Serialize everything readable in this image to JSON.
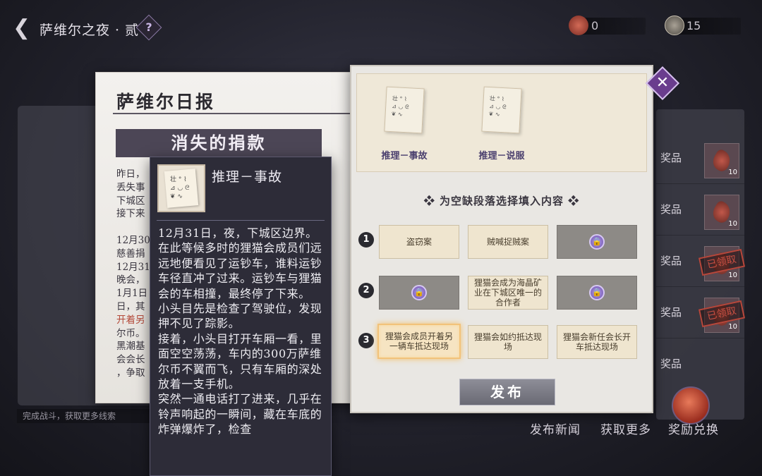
{
  "header": {
    "title": "萨维尔之夜 · 贰",
    "help_label": "?",
    "back_icon": "chevron-left-icon",
    "resources": [
      {
        "icon": "maple-leaf-icon",
        "value": "0",
        "color": "#c2584a"
      },
      {
        "icon": "coin-icon",
        "value": "15",
        "color": "#b8b0a0"
      }
    ]
  },
  "background": {
    "left_footer": "完成战斗，获取更多线索",
    "rewards": [
      {
        "label": "奖品",
        "count": "10",
        "claimed": false
      },
      {
        "label": "奖品",
        "count": "10",
        "claimed": false
      },
      {
        "label": "奖品",
        "count": "10",
        "claimed": true
      },
      {
        "label": "奖品",
        "count": "10",
        "claimed": true
      },
      {
        "label": "奖品",
        "count": "",
        "claimed": false
      }
    ],
    "claimed_text": "已领取",
    "bottom_buttons": [
      "发布新闻",
      "获取更多",
      "奖励兑换"
    ]
  },
  "newspaper": {
    "masthead": "萨维尔日报",
    "headline": "消失的捐款",
    "column_lines": [
      {
        "text": "昨日，",
        "red": false
      },
      {
        "text": "丢失事",
        "red": false
      },
      {
        "text": "下城区",
        "red": false
      },
      {
        "text": "接下来",
        "red": false
      },
      {
        "text": "",
        "red": false
      },
      {
        "text": "12月30",
        "red": false
      },
      {
        "text": "慈善捐",
        "red": false
      },
      {
        "text": "12月31",
        "red": false
      },
      {
        "text": "晚会，",
        "red": false
      },
      {
        "text": "1月1日",
        "red": false
      },
      {
        "text": "日，其",
        "red": false
      },
      {
        "text": "开着另",
        "red": true
      },
      {
        "text": "尔币。",
        "red": false
      },
      {
        "text": "黑潮基",
        "red": false
      },
      {
        "text": "会会长",
        "red": false
      },
      {
        "text": "，争取",
        "red": false
      }
    ]
  },
  "tooltip": {
    "title": "推理－事故",
    "body": "12月31日，夜，下城区边界。\n在此等候多时的狸猫会成员们远远地便看见了运钞车，谁料运钞车径直冲了过来。运钞车与狸猫会的车相撞，最终停了下来。\n小头目先是检查了驾驶位，发现押不见了踪影。\n接着，小头目打开车厢一看，里面空空荡荡，车内的300万萨维尔币不翼而飞，只有车厢的深处放着一支手机。\n突然一通电话打了进来，几乎在铃声响起的一瞬间，藏在车底的炸弹爆炸了，检查"
  },
  "quiz": {
    "clues": [
      {
        "label": "推理－事故"
      },
      {
        "label": "推理－说服"
      }
    ],
    "instruction": "为空缺段落选择填入内容",
    "rows": [
      {
        "num": "1",
        "options": [
          {
            "text": "盗窃案",
            "state": "normal"
          },
          {
            "text": "贼喊捉贼案",
            "state": "normal"
          },
          {
            "text": "",
            "state": "locked"
          }
        ]
      },
      {
        "num": "2",
        "options": [
          {
            "text": "",
            "state": "locked"
          },
          {
            "text": "狸猫会成为海晶矿业在下城区唯一的合作者",
            "state": "normal"
          },
          {
            "text": "",
            "state": "locked"
          }
        ]
      },
      {
        "num": "3",
        "options": [
          {
            "text": "狸猫会成员开着另一辆车抵达现场",
            "state": "selected"
          },
          {
            "text": "狸猫会如约抵达现场",
            "state": "normal"
          },
          {
            "text": "狸猫会新任会长开车抵达现场",
            "state": "normal"
          }
        ]
      }
    ],
    "publish_label": "发布",
    "close_label": "✕"
  }
}
